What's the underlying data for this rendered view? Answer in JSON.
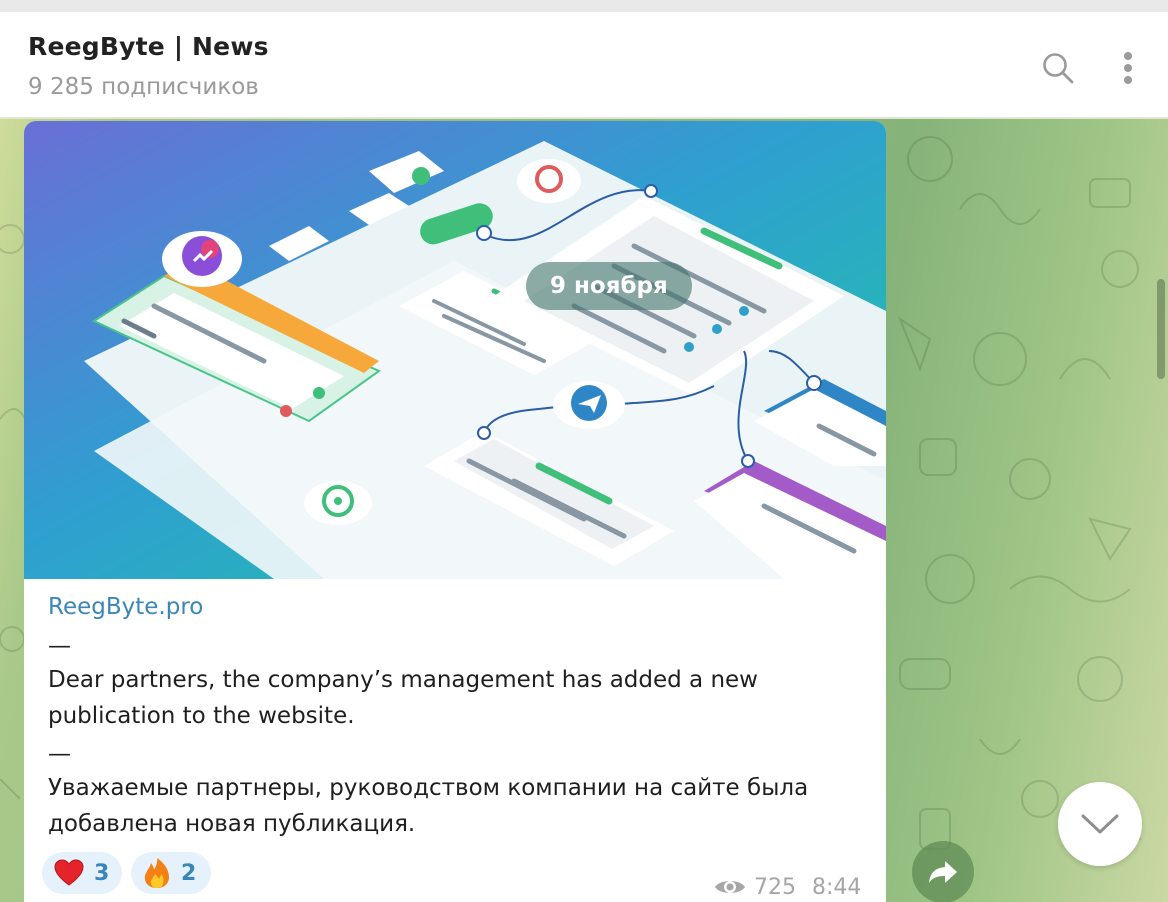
{
  "header": {
    "title": "ReegByte | News",
    "subtitle": "9 285 подписчиков"
  },
  "date_pill": "9 ноября",
  "message": {
    "link": "ReegByte.pro",
    "dash1": "—",
    "para1": "Dear partners, the company’s management has added a new publication to the website.",
    "dash2": "—",
    "para2": "Уважаемые партнеры, руководством компании на сайте была добавлена новая публикация.",
    "reactions": [
      {
        "emoji": "heart",
        "count": "3"
      },
      {
        "emoji": "fire",
        "count": "2"
      }
    ],
    "views": "725",
    "time": "8:44"
  },
  "icons": {
    "search": "search-icon",
    "more": "more-vertical-icon",
    "forward": "forward-icon",
    "scroll_down": "chevron-down-icon",
    "views": "eye-icon"
  },
  "colors": {
    "accent": "#3a86b9",
    "reaction_bg": "#e6f2fb",
    "date_pill": "#46786e"
  }
}
